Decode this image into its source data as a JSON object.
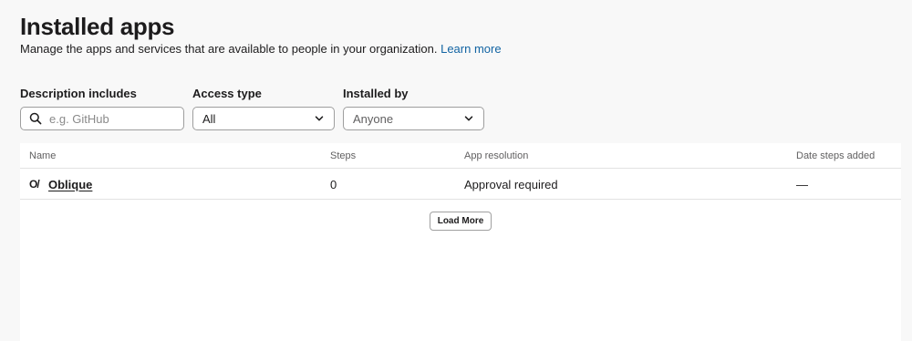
{
  "header": {
    "title": "Installed apps",
    "description": "Manage the apps and services that are available to people in your organization.",
    "learn_more_link": "Learn more"
  },
  "filters": {
    "description": {
      "label": "Description includes",
      "placeholder": "e.g. GitHub",
      "value": ""
    },
    "access_type": {
      "label": "Access type",
      "selected": "All"
    },
    "installed_by": {
      "label": "Installed by",
      "selected": "Anyone"
    }
  },
  "table": {
    "columns": [
      "Name",
      "Steps",
      "App resolution",
      "Date steps added"
    ],
    "rows": [
      {
        "icon_text": "O/",
        "name": "Oblique",
        "steps": "0",
        "resolution": "Approval required",
        "date_added": "—"
      }
    ],
    "load_more_label": "Load More"
  },
  "colors": {
    "link": "#1264a3",
    "text": "#1d1c1d",
    "background": "#f8f8f8"
  }
}
